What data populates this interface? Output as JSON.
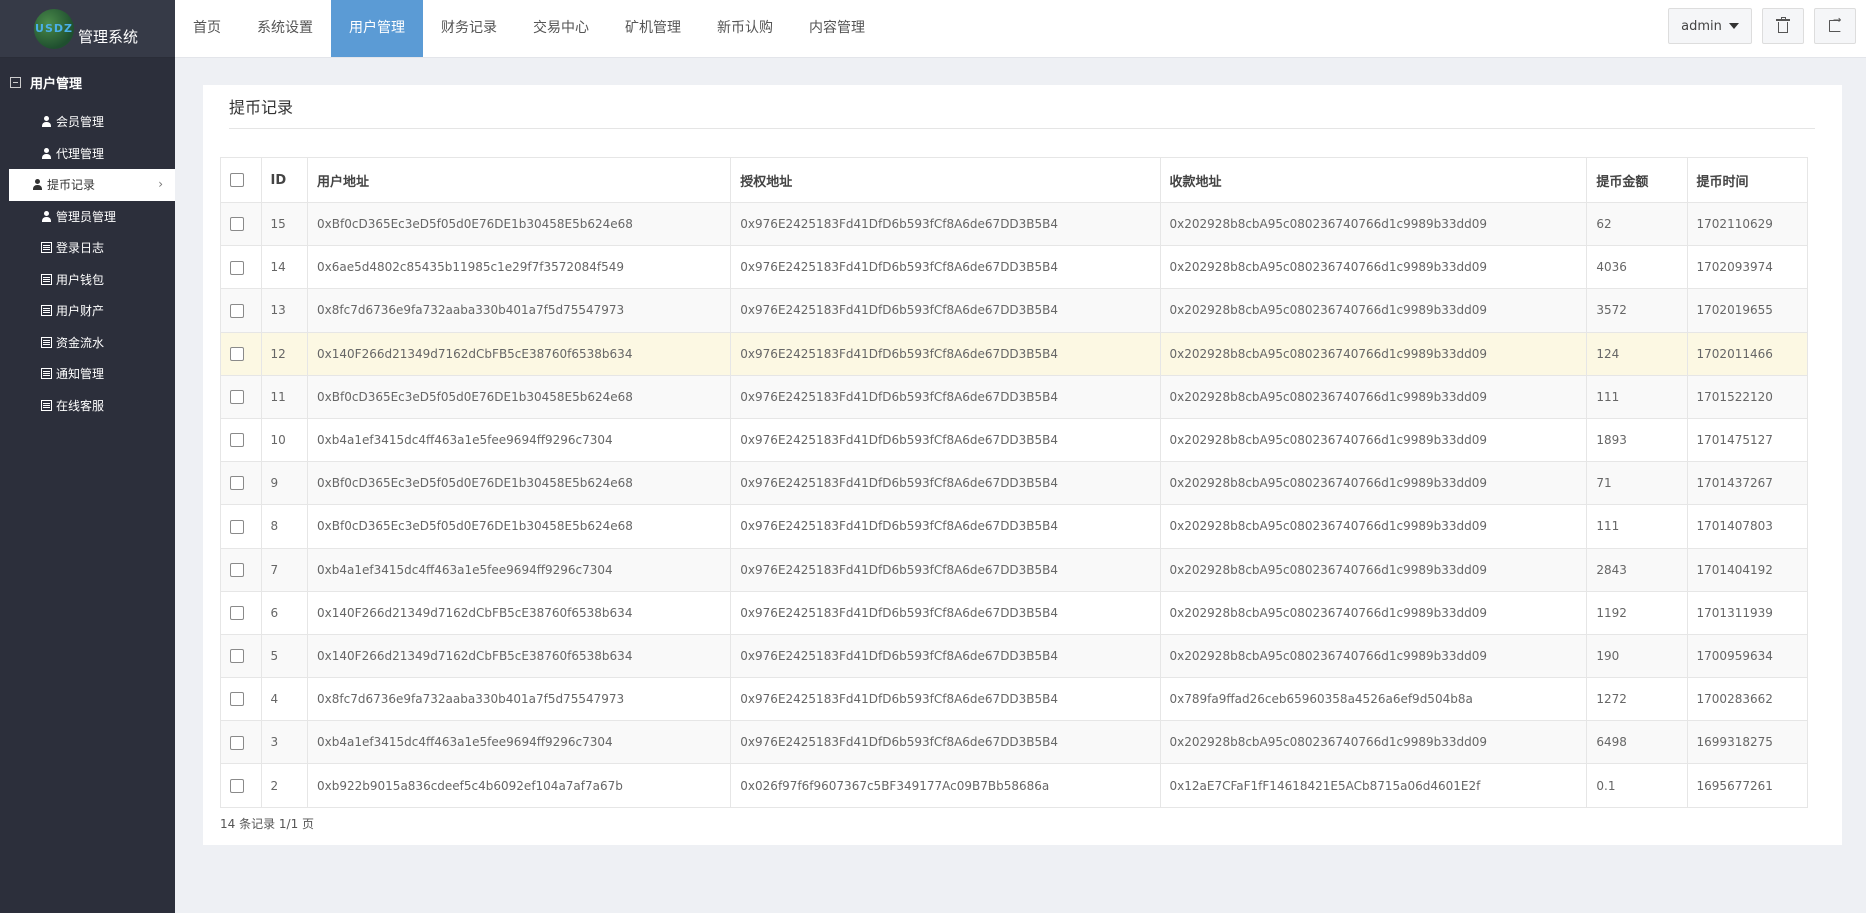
{
  "app": {
    "logo_text": "USDZ",
    "title": "管理系统"
  },
  "sidebar": {
    "section_label": "用户管理",
    "items": [
      {
        "label": "会员管理",
        "icon": "person-icon"
      },
      {
        "label": "代理管理",
        "icon": "person-icon"
      },
      {
        "label": "提币记录",
        "icon": "person-icon",
        "active": true
      },
      {
        "label": "管理员管理",
        "icon": "person-icon"
      },
      {
        "label": "登录日志",
        "icon": "list-icon"
      },
      {
        "label": "用户钱包",
        "icon": "list-icon"
      },
      {
        "label": "用户财产",
        "icon": "list-icon"
      },
      {
        "label": "资金流水",
        "icon": "list-icon"
      },
      {
        "label": "通知管理",
        "icon": "list-icon"
      },
      {
        "label": "在线客服",
        "icon": "list-icon"
      }
    ]
  },
  "topbar": {
    "tabs": [
      "首页",
      "系统设置",
      "用户管理",
      "财务记录",
      "交易中心",
      "矿机管理",
      "新币认购",
      "内容管理"
    ],
    "active_tab": "用户管理",
    "user": "admin"
  },
  "page": {
    "title": "提币记录"
  },
  "table": {
    "headers": [
      "ID",
      "用户地址",
      "授权地址",
      "收款地址",
      "提币金额",
      "提币时间"
    ],
    "rows": [
      [
        "15",
        "0xBf0cD365Ec3eD5f05d0E76DE1b30458E5b624e68",
        "0x976E2425183Fd41DfD6b593fCf8A6de67DD3B5B4",
        "0x202928b8cbA95c080236740766d1c9989b33dd09",
        "62",
        "1702110629"
      ],
      [
        "14",
        "0x6ae5d4802c85435b11985c1e29f7f3572084f549",
        "0x976E2425183Fd41DfD6b593fCf8A6de67DD3B5B4",
        "0x202928b8cbA95c080236740766d1c9989b33dd09",
        "4036",
        "1702093974"
      ],
      [
        "13",
        "0x8fc7d6736e9fa732aaba330b401a7f5d75547973",
        "0x976E2425183Fd41DfD6b593fCf8A6de67DD3B5B4",
        "0x202928b8cbA95c080236740766d1c9989b33dd09",
        "3572",
        "1702019655"
      ],
      [
        "12",
        "0x140F266d21349d7162dCbFB5cE38760f6538b634",
        "0x976E2425183Fd41DfD6b593fCf8A6de67DD3B5B4",
        "0x202928b8cbA95c080236740766d1c9989b33dd09",
        "124",
        "1702011466"
      ],
      [
        "11",
        "0xBf0cD365Ec3eD5f05d0E76DE1b30458E5b624e68",
        "0x976E2425183Fd41DfD6b593fCf8A6de67DD3B5B4",
        "0x202928b8cbA95c080236740766d1c9989b33dd09",
        "111",
        "1701522120"
      ],
      [
        "10",
        "0xb4a1ef3415dc4ff463a1e5fee9694ff9296c7304",
        "0x976E2425183Fd41DfD6b593fCf8A6de67DD3B5B4",
        "0x202928b8cbA95c080236740766d1c9989b33dd09",
        "1893",
        "1701475127"
      ],
      [
        "9",
        "0xBf0cD365Ec3eD5f05d0E76DE1b30458E5b624e68",
        "0x976E2425183Fd41DfD6b593fCf8A6de67DD3B5B4",
        "0x202928b8cbA95c080236740766d1c9989b33dd09",
        "71",
        "1701437267"
      ],
      [
        "8",
        "0xBf0cD365Ec3eD5f05d0E76DE1b30458E5b624e68",
        "0x976E2425183Fd41DfD6b593fCf8A6de67DD3B5B4",
        "0x202928b8cbA95c080236740766d1c9989b33dd09",
        "111",
        "1701407803"
      ],
      [
        "7",
        "0xb4a1ef3415dc4ff463a1e5fee9694ff9296c7304",
        "0x976E2425183Fd41DfD6b593fCf8A6de67DD3B5B4",
        "0x202928b8cbA95c080236740766d1c9989b33dd09",
        "2843",
        "1701404192"
      ],
      [
        "6",
        "0x140F266d21349d7162dCbFB5cE38760f6538b634",
        "0x976E2425183Fd41DfD6b593fCf8A6de67DD3B5B4",
        "0x202928b8cbA95c080236740766d1c9989b33dd09",
        "1192",
        "1701311939"
      ],
      [
        "5",
        "0x140F266d21349d7162dCbFB5cE38760f6538b634",
        "0x976E2425183Fd41DfD6b593fCf8A6de67DD3B5B4",
        "0x202928b8cbA95c080236740766d1c9989b33dd09",
        "190",
        "1700959634"
      ],
      [
        "4",
        "0x8fc7d6736e9fa732aaba330b401a7f5d75547973",
        "0x976E2425183Fd41DfD6b593fCf8A6de67DD3B5B4",
        "0x789fa9ffad26ceb65960358a4526a6ef9d504b8a",
        "1272",
        "1700283662"
      ],
      [
        "3",
        "0xb4a1ef3415dc4ff463a1e5fee9694ff9296c7304",
        "0x976E2425183Fd41DfD6b593fCf8A6de67DD3B5B4",
        "0x202928b8cbA95c080236740766d1c9989b33dd09",
        "6498",
        "1699318275"
      ],
      [
        "2",
        "0xb922b9015a836cdeef5c4b6092ef104a7af7a67b",
        "0x026f97f6f9607367c5BF349177Ac09B7Bb58686a",
        "0x12aE7CFaF1fF14618421E5ACb8715a06d4601E2f",
        "0.1",
        "1695677261"
      ]
    ],
    "highlight_row_id": "12",
    "footer": "14 条记录 1/1 页"
  },
  "colors": {
    "sidebar_bg": "#2c2f3b",
    "active_tab": "#5b9bd5",
    "highlight_row": "#fcf8e3"
  }
}
